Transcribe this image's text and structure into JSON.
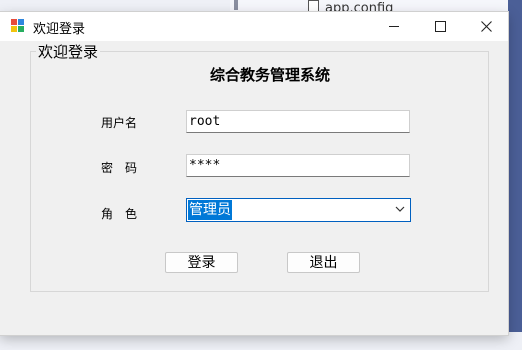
{
  "background": {
    "file_name": "app.config"
  },
  "window": {
    "title": "欢迎登录"
  },
  "form": {
    "group_label": "欢迎登录",
    "system_title": "综合教务管理系统",
    "username_label": "用户名",
    "password_label": "密码",
    "role_label": "角色",
    "username_value": "root",
    "password_value": "****",
    "role_value": "管理员",
    "login_button": "登录",
    "exit_button": "退出"
  }
}
